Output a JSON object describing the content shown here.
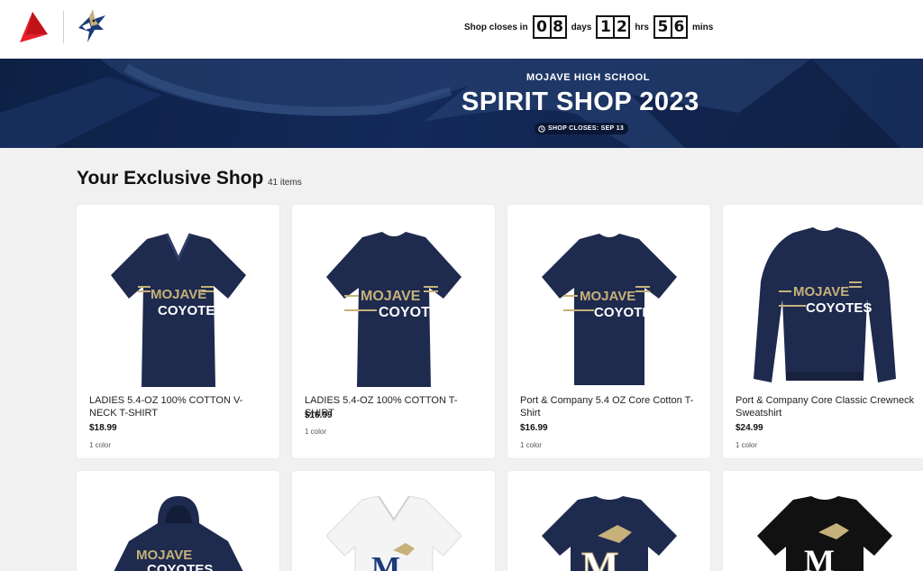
{
  "header": {
    "countdown": {
      "label": "Shop closes in",
      "days": [
        "0",
        "8"
      ],
      "days_label": "days",
      "hours": [
        "1",
        "2"
      ],
      "hours_label": "hrs",
      "mins": [
        "5",
        "6"
      ],
      "mins_label": "mins"
    }
  },
  "hero": {
    "school": "MOJAVE HIGH SCHOOL",
    "title": "SPIRIT SHOP 2023",
    "badge": "SHOP CLOSES: SEP 13"
  },
  "shop": {
    "title": "Your Exclusive Shop",
    "count": "41 items"
  },
  "products": [
    {
      "name": "LADIES 5.4-OZ 100% COTTON V-NECK T-SHIRT",
      "price": "$18.99",
      "colors": "1 color",
      "image": "navy-vneck-tee",
      "garment_color": "#1e2a4e"
    },
    {
      "name": "LADIES 5.4-OZ 100% COTTON T-SHIRT",
      "price": "$16.99",
      "colors": "1 color",
      "image": "navy-tee",
      "garment_color": "#1e2a4e"
    },
    {
      "name": "Port & Company 5.4 OZ Core Cotton T-Shirt",
      "price": "$16.99",
      "colors": "1 color",
      "image": "navy-tee",
      "garment_color": "#1e2a4e"
    },
    {
      "name": "Port & Company Core Classic Crewneck Sweatshirt",
      "price": "$24.99",
      "colors": "1 color",
      "image": "navy-sweatshirt",
      "garment_color": "#1e2a4e"
    },
    {
      "image": "navy-hoodie",
      "garment_color": "#1e2a4e"
    },
    {
      "image": "white-vneck-tee",
      "garment_color": "#f4f4f4"
    },
    {
      "image": "navy-tee-m-logo",
      "garment_color": "#1e2a4e"
    },
    {
      "image": "black-tee-m-logo",
      "garment_color": "#111111"
    }
  ],
  "colors": {
    "brand_red": "#e8202a",
    "navy": "#13295a",
    "gold": "#c6b17a"
  }
}
